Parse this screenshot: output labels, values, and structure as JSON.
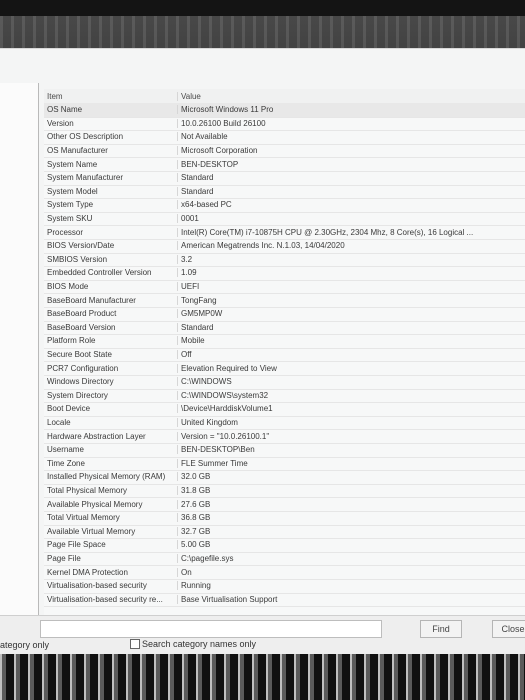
{
  "header": {
    "item": "Item",
    "value": "Value"
  },
  "rows": [
    {
      "item": "OS Name",
      "value": "Microsoft Windows 11 Pro"
    },
    {
      "item": "Version",
      "value": "10.0.26100 Build 26100"
    },
    {
      "item": "Other OS Description",
      "value": "Not Available"
    },
    {
      "item": "OS Manufacturer",
      "value": "Microsoft Corporation"
    },
    {
      "item": "System Name",
      "value": "BEN-DESKTOP"
    },
    {
      "item": "System Manufacturer",
      "value": "Standard"
    },
    {
      "item": "System Model",
      "value": "Standard"
    },
    {
      "item": "System Type",
      "value": "x64-based PC"
    },
    {
      "item": "System SKU",
      "value": "0001"
    },
    {
      "item": "Processor",
      "value": "Intel(R) Core(TM) i7-10875H CPU @ 2.30GHz, 2304 Mhz, 8 Core(s), 16 Logical ..."
    },
    {
      "item": "BIOS Version/Date",
      "value": "American Megatrends Inc. N.1.03, 14/04/2020"
    },
    {
      "item": "SMBIOS Version",
      "value": "3.2"
    },
    {
      "item": "Embedded Controller Version",
      "value": "1.09"
    },
    {
      "item": "BIOS Mode",
      "value": "UEFI"
    },
    {
      "item": "BaseBoard Manufacturer",
      "value": "TongFang"
    },
    {
      "item": "BaseBoard Product",
      "value": "GM5MP0W"
    },
    {
      "item": "BaseBoard Version",
      "value": "Standard"
    },
    {
      "item": "Platform Role",
      "value": "Mobile"
    },
    {
      "item": "Secure Boot State",
      "value": "Off"
    },
    {
      "item": "PCR7 Configuration",
      "value": "Elevation Required to View"
    },
    {
      "item": "Windows Directory",
      "value": "C:\\WINDOWS"
    },
    {
      "item": "System Directory",
      "value": "C:\\WINDOWS\\system32"
    },
    {
      "item": "Boot Device",
      "value": "\\Device\\HarddiskVolume1"
    },
    {
      "item": "Locale",
      "value": "United Kingdom"
    },
    {
      "item": "Hardware Abstraction Layer",
      "value": "Version = \"10.0.26100.1\""
    },
    {
      "item": "Username",
      "value": "BEN-DESKTOP\\Ben"
    },
    {
      "item": "Time Zone",
      "value": "FLE Summer Time"
    },
    {
      "item": "Installed Physical Memory (RAM)",
      "value": "32.0 GB"
    },
    {
      "item": "Total Physical Memory",
      "value": "31.8 GB"
    },
    {
      "item": "Available Physical Memory",
      "value": "27.6 GB"
    },
    {
      "item": "Total Virtual Memory",
      "value": "36.8 GB"
    },
    {
      "item": "Available Virtual Memory",
      "value": "32.7 GB"
    },
    {
      "item": "Page File Space",
      "value": "5.00 GB"
    },
    {
      "item": "Page File",
      "value": "C:\\pagefile.sys"
    },
    {
      "item": "Kernel DMA Protection",
      "value": "On"
    },
    {
      "item": "Virtualisation-based security",
      "value": "Running"
    },
    {
      "item": "Virtualisation-based security re...",
      "value": "Base Virtualisation Support"
    }
  ],
  "find_bar": {
    "find_label": "Find",
    "close_label": "Close",
    "search_selected_label": "ategory only",
    "search_names_label": "Search category names only"
  }
}
